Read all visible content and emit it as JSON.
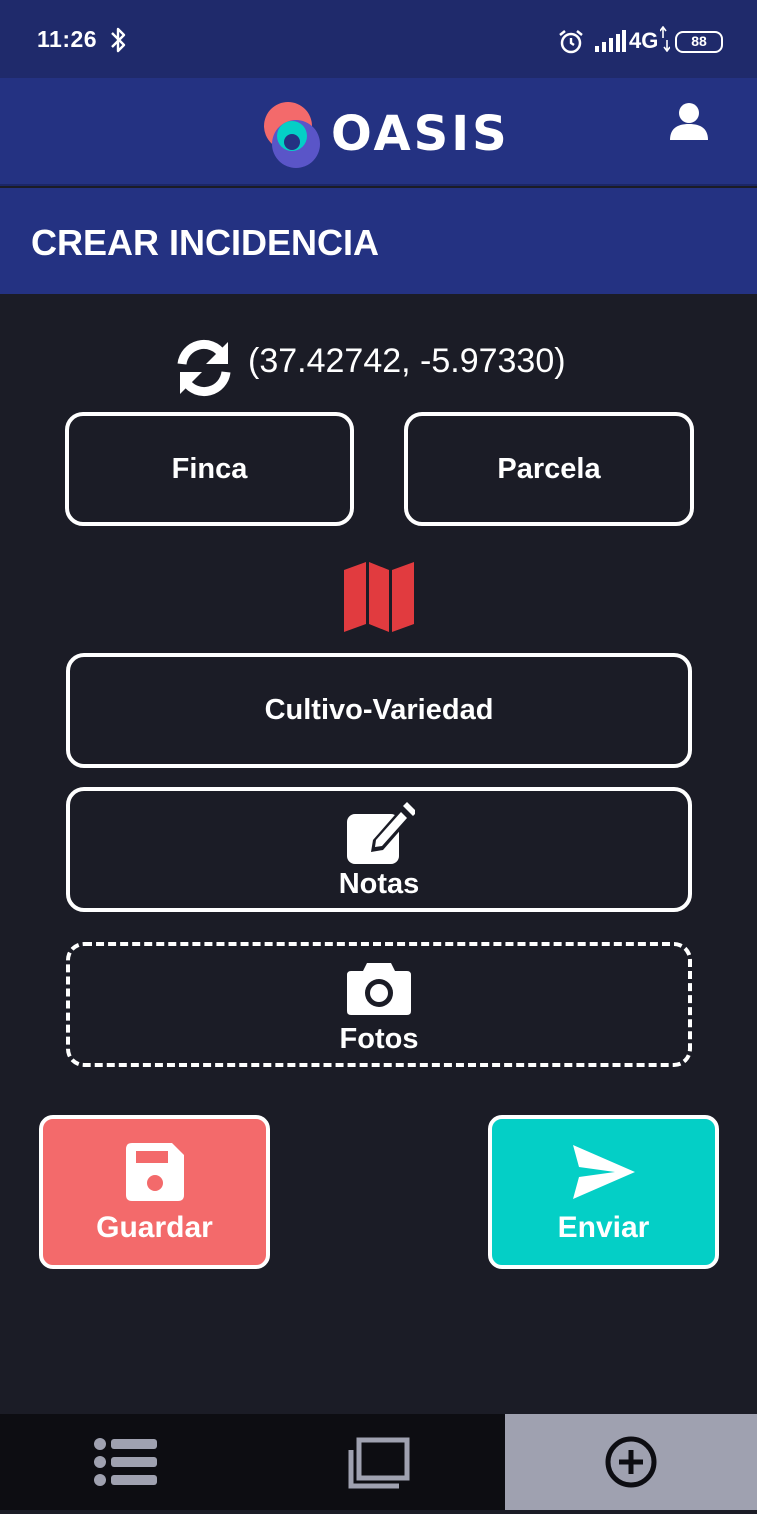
{
  "status_bar": {
    "time": "11:26",
    "network": "4G",
    "battery": "88",
    "icons": [
      "bluetooth-icon",
      "alarm-icon",
      "signal-icon",
      "battery-icon"
    ]
  },
  "app": {
    "brand": "OASIS",
    "user_icon": "user-icon"
  },
  "page": {
    "title": "CREAR INCIDENCIA"
  },
  "location": {
    "coords": "(37.42742, -5.97330)",
    "refresh_icon": "refresh-icon"
  },
  "fields": {
    "finca": "Finca",
    "parcela": "Parcela",
    "map_icon": "map-icon",
    "cultivo": "Cultivo-Variedad",
    "notas": "Notas",
    "fotos": "Fotos"
  },
  "actions": {
    "guardar": "Guardar",
    "enviar": "Enviar"
  },
  "nav": {
    "items": [
      {
        "icon": "list-icon",
        "active": false
      },
      {
        "icon": "folders-icon",
        "active": false
      },
      {
        "icon": "add-circle-icon",
        "active": true
      }
    ]
  },
  "colors": {
    "header": "#243282",
    "statusbar": "#1f2a6b",
    "background": "#1b1c26",
    "guardar": "#f36a6b",
    "enviar": "#04cfc6",
    "map": "#e13b3f",
    "nav_active": "#9fa1b0"
  }
}
